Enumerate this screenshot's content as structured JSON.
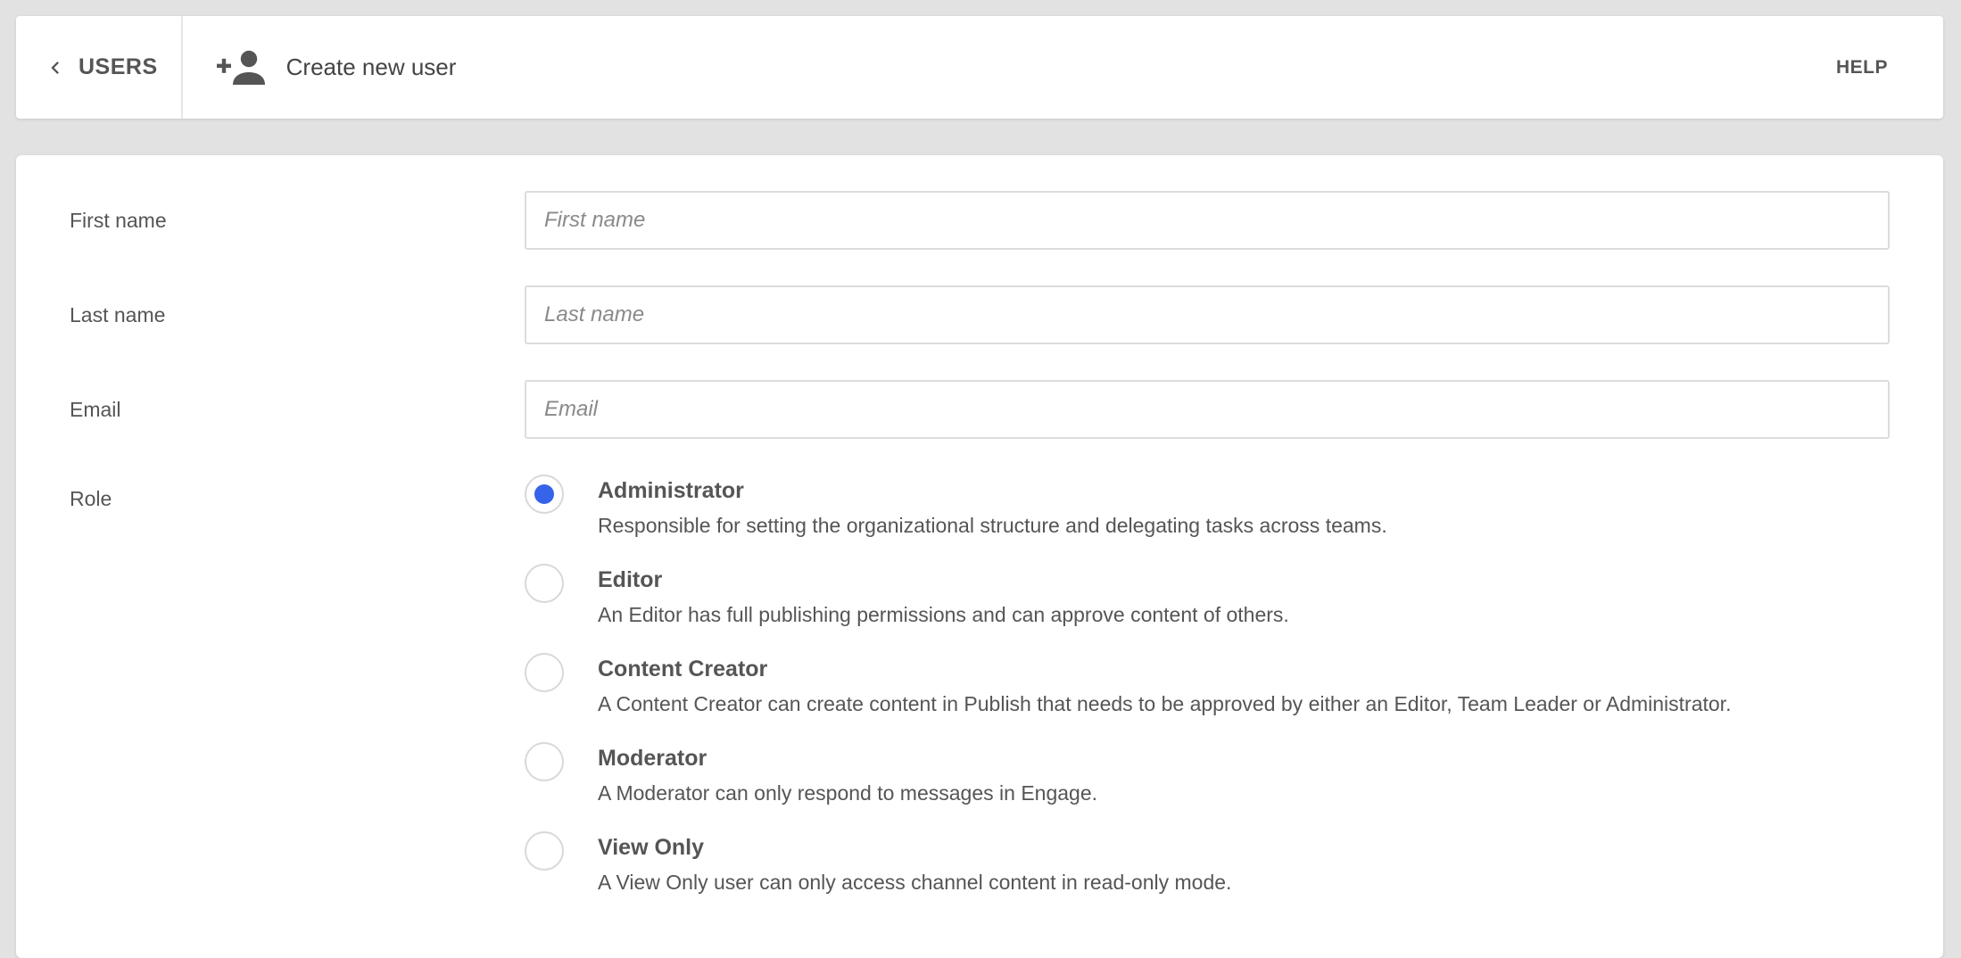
{
  "header": {
    "back_label": "USERS",
    "title": "Create new user",
    "help_label": "HELP"
  },
  "form": {
    "first_name": {
      "label": "First name",
      "placeholder": "First name",
      "value": ""
    },
    "last_name": {
      "label": "Last name",
      "placeholder": "Last name",
      "value": ""
    },
    "email": {
      "label": "Email",
      "placeholder": "Email",
      "value": ""
    },
    "role": {
      "label": "Role",
      "selected": "Administrator",
      "options": [
        {
          "name": "Administrator",
          "description": "Responsible for setting the organizational structure and delegating tasks across teams."
        },
        {
          "name": "Editor",
          "description": "An Editor has full publishing permissions and can approve content of others."
        },
        {
          "name": "Content Creator",
          "description": "A Content Creator can create content in Publish that needs to be approved by either an Editor, Team Leader or Administrator."
        },
        {
          "name": "Moderator",
          "description": "A Moderator can only respond to messages in Engage."
        },
        {
          "name": "View Only",
          "description": "A View Only user can only access channel content in read-only mode."
        }
      ]
    }
  },
  "colors": {
    "accent": "#3563e9",
    "background": "#e2e2e2",
    "text": "#555555"
  },
  "icons": {
    "back": "chevron-left-icon",
    "title": "person-add-icon"
  }
}
